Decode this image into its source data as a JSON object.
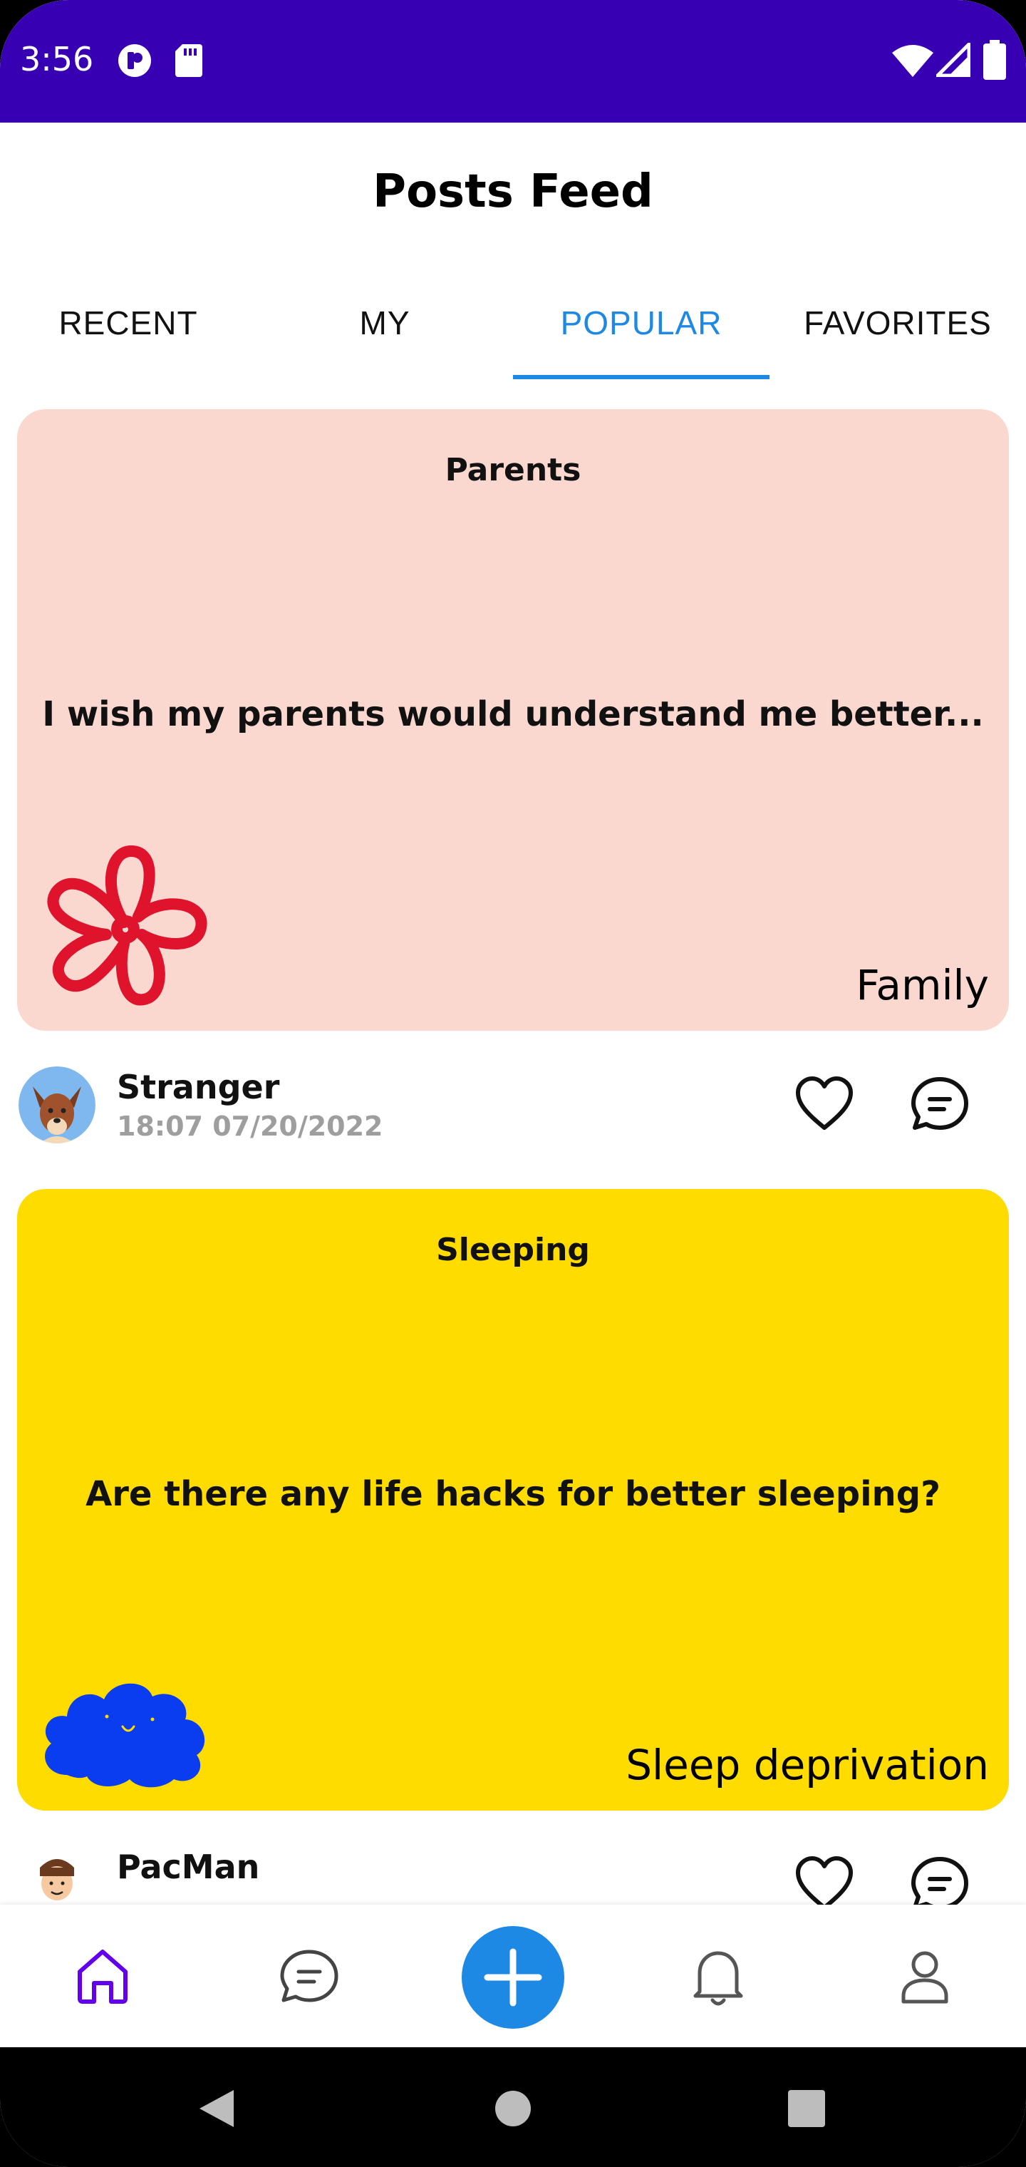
{
  "status_bar": {
    "time": "3:56",
    "icons": [
      "podcast-icon",
      "sd-card-icon",
      "wifi-icon",
      "signal-icon",
      "battery-icon"
    ]
  },
  "header": {
    "title": "Posts Feed"
  },
  "tabs": [
    {
      "label": "RECENT",
      "active": false
    },
    {
      "label": "MY",
      "active": false
    },
    {
      "label": "POPULAR",
      "active": true
    },
    {
      "label": "FAVORITES",
      "active": false
    }
  ],
  "posts": [
    {
      "category": "Parents",
      "text": "I wish my parents would understand me better...",
      "tag": "Family",
      "background": "#FBD8CF",
      "decoration": "flower-icon",
      "decoration_color": "#E0132D",
      "author": "Stranger",
      "date": "18:07 07/20/2022"
    },
    {
      "category": "Sleeping",
      "text": "Are there any life hacks for better sleeping?",
      "tag": "Sleep deprivation",
      "background": "#FEDC00",
      "decoration": "cloud-icon",
      "decoration_color": "#0A3CF0",
      "author": "PacMan",
      "date": ""
    }
  ],
  "bottom_nav": {
    "items": [
      "home-icon",
      "chat-icon",
      "add-icon",
      "bell-icon",
      "profile-icon"
    ],
    "active": "home-icon",
    "active_color": "#6200EE",
    "fab_color": "#1E88E5"
  },
  "colors": {
    "status_bar": "#3700B3",
    "accent": "#1E88E5"
  }
}
